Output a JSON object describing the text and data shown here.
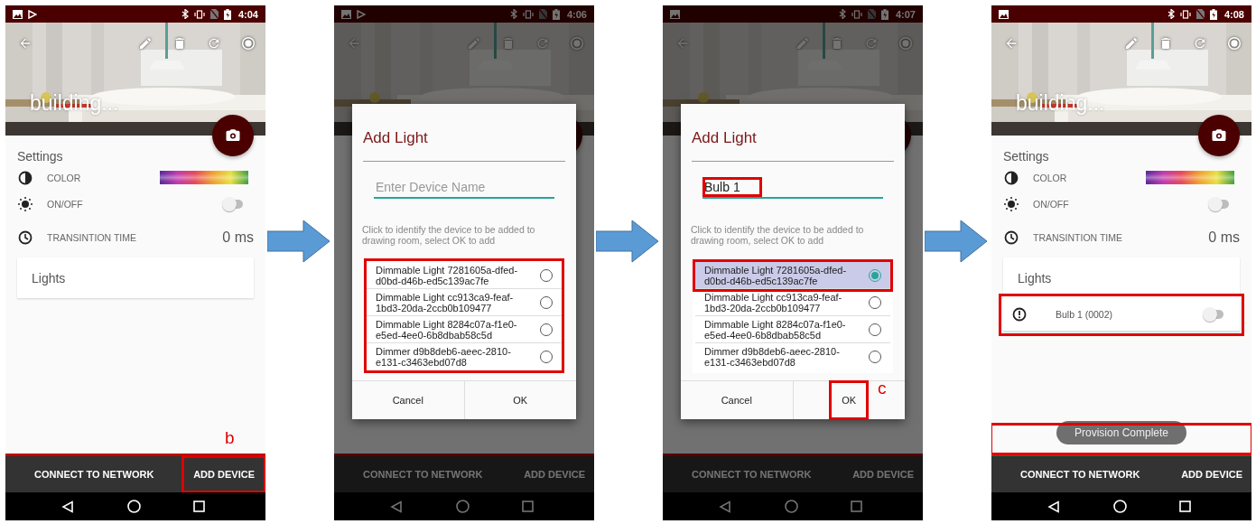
{
  "screens": [
    {
      "status_bar": {
        "time": "4:04",
        "media_icon": true
      },
      "photo_title": "building...",
      "settings": {
        "heading": "Settings",
        "rows": [
          {
            "kind": "color",
            "label": "COLOR"
          },
          {
            "kind": "toggle",
            "label": "ON/OFF",
            "on": false
          },
          {
            "kind": "value",
            "label": "TRANSINTION TIME",
            "value": "0 ms"
          }
        ]
      },
      "lights": {
        "heading": "Lights"
      },
      "actions": [
        {
          "label": "CONNECT TO NETWORK",
          "highlighted": false
        },
        {
          "label": "ADD DEVICE",
          "highlighted": true,
          "annotation": "b"
        }
      ]
    },
    {
      "status_bar": {
        "time": "4:06",
        "media_icon": true
      },
      "actions": [
        {
          "label": "CONNECT TO NETWORK",
          "highlighted": false
        },
        {
          "label": "ADD DEVICE",
          "highlighted": false
        }
      ],
      "dialog": {
        "title": "Add Light",
        "name_field": {
          "placeholder": "Enter Device Name",
          "highlighted": false
        },
        "instructions": "Click to identify the device to be added to drawing room, select OK to add",
        "device_list": {
          "highlighted": true,
          "items": [
            {
              "name": "Dimmable Light 7281605a-dfed-d0bd-d46b-ed5c139ac7fe",
              "selected": false,
              "highlighted": false
            },
            {
              "name": "Dimmable Light cc913ca9-feaf-1bd3-20da-2ccb0b109477",
              "selected": false,
              "highlighted": false
            },
            {
              "name": "Dimmable Light 8284c07a-f1e0-e5ed-4ee0-6b8dbab58c5d",
              "selected": false,
              "highlighted": false
            },
            {
              "name": "Dimmer d9b8deb6-aeec-2810-e131-c3463ebd07d8",
              "selected": false,
              "highlighted": false
            }
          ]
        },
        "buttons": [
          {
            "label": "Cancel",
            "highlighted": false
          },
          {
            "label": "OK",
            "highlighted": false
          }
        ]
      }
    },
    {
      "status_bar": {
        "time": "4:07",
        "media_icon": false
      },
      "actions": [
        {
          "label": "CONNECT TO NETWORK",
          "highlighted": false
        },
        {
          "label": "ADD DEVICE",
          "highlighted": false
        }
      ],
      "dialog": {
        "title": "Add Light",
        "name_field": {
          "value": "Bulb 1",
          "highlighted": true
        },
        "instructions": "Click to identify the device to be added to drawing room, select OK to add",
        "device_list": {
          "items": [
            {
              "name": "Dimmable Light 7281605a-dfed-d0bd-d46b-ed5c139ac7fe",
              "selected": true,
              "highlighted": true
            },
            {
              "name": "Dimmable Light cc913ca9-feaf-1bd3-20da-2ccb0b109477",
              "selected": false,
              "highlighted": false
            },
            {
              "name": "Dimmable Light 8284c07a-f1e0-e5ed-4ee0-6b8dbab58c5d",
              "selected": false,
              "highlighted": false
            },
            {
              "name": "Dimmer d9b8deb6-aeec-2810-e131-c3463ebd07d8",
              "selected": false,
              "highlighted": false
            }
          ]
        },
        "buttons": [
          {
            "label": "Cancel",
            "highlighted": false
          },
          {
            "label": "OK",
            "highlighted": true,
            "annotation": "c"
          }
        ]
      }
    },
    {
      "status_bar": {
        "time": "4:08",
        "media_icon": false
      },
      "photo_title": "building...",
      "settings": {
        "heading": "Settings",
        "rows": [
          {
            "kind": "color",
            "label": "COLOR"
          },
          {
            "kind": "toggle",
            "label": "ON/OFF",
            "on": false
          },
          {
            "kind": "value",
            "label": "TRANSINTION TIME",
            "value": "0 ms"
          }
        ]
      },
      "lights": {
        "heading": "Lights",
        "items": [
          {
            "name": "Bulb 1 (0002)",
            "on": false,
            "highlighted": true
          }
        ]
      },
      "toast": {
        "text": "Provision Complete",
        "highlighted": true
      },
      "actions": [
        {
          "label": "CONNECT TO NETWORK",
          "highlighted": false
        },
        {
          "label": "ADD DEVICE",
          "highlighted": false
        }
      ]
    }
  ]
}
